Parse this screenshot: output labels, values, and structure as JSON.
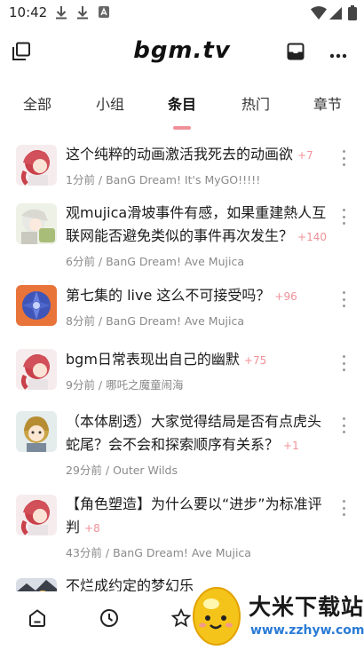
{
  "status_bar": {
    "time": "10:42"
  },
  "header": {
    "title": "bgm.tv"
  },
  "tabs": [
    {
      "label": "全部"
    },
    {
      "label": "小组"
    },
    {
      "label": "条目"
    },
    {
      "label": "热门"
    },
    {
      "label": "章节"
    }
  ],
  "active_tab": "条目",
  "accent_color": "#f09199",
  "topics": [
    {
      "title": "这个纯粹的动画激活我死去的动画欲",
      "replies": "+7",
      "meta": "1分前 / BanG Dream! It's MyGO!!!!!"
    },
    {
      "title": "观mujica滑坡事件有感，如果重建熱人互联网能否避免类似的事件再次发生？",
      "replies": "+140",
      "meta": "6分前 / BanG Dream! Ave Mujica"
    },
    {
      "title": "第七集的 live 这么不可接受吗？",
      "replies": "+96",
      "meta": "8分前 / BanG Dream! Ave Mujica"
    },
    {
      "title": "bgm日常表现出自己的幽默",
      "replies": "+75",
      "meta": "9分前 / 哪吒之魔童闹海"
    },
    {
      "title": "（本体剧透）大家觉得结局是否有点虎头蛇尾？会不会和探索顺序有关系？",
      "replies": "+1",
      "meta": "29分前 / Outer Wilds"
    },
    {
      "title": "【角色塑造】为什么要以“进步”为标准评判",
      "replies": "+8",
      "meta": "43分前 / BanG Dream! Ave Mujica"
    },
    {
      "title": "不烂成约定的梦幻乐",
      "replies": "",
      "meta": ""
    }
  ],
  "bottom_nav": [
    {
      "icon": "home-icon"
    },
    {
      "icon": "clock-icon"
    },
    {
      "icon": "star-icon"
    }
  ],
  "watermark": {
    "text": "大米下载站",
    "url": "www.zzhyw.com"
  }
}
